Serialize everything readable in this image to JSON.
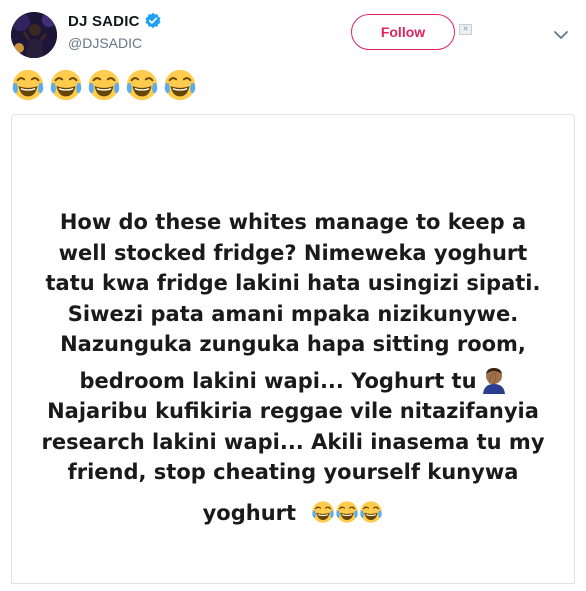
{
  "user": {
    "display_name": "DJ SADIC",
    "handle": "@DJSADIC",
    "verified": true
  },
  "follow_label": "Follow",
  "tweet_emojis": [
    "face-with-tears-of-joy",
    "face-with-tears-of-joy",
    "face-with-tears-of-joy",
    "face-with-tears-of-joy",
    "face-with-tears-of-joy"
  ],
  "media": {
    "lines": [
      "How do these whites manage to keep a",
      "well stocked fridge? Nimeweka yoghurt",
      "tatu kwa fridge lakini hata usingizi sipati.",
      "Siwezi pata amani mpaka nizikunywe.",
      "Nazunguka zunguka hapa sitting room,",
      "bedroom lakini wapi... Yoghurt tu",
      "Najaribu kufikiria reggae vile nitazifanyia",
      "research lakini wapi... Akili inasema tu my",
      "friend, stop cheating yourself kunywa",
      "yoghurt"
    ],
    "line6_emoji": "man-facepalming",
    "last_line_emojis": [
      "face-with-tears-of-joy",
      "face-with-tears-of-joy",
      "face-with-tears-of-joy"
    ]
  },
  "colors": {
    "follow_accent": "#e0245e",
    "verified_blue": "#1da1f2",
    "handle_gray": "#657786"
  }
}
